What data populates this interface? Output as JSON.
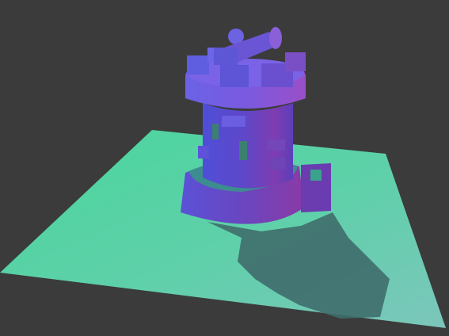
{
  "viewport": {
    "background_color": "#3b3b3b"
  },
  "scene": {
    "shading_mode": "normal-map",
    "objects": [
      {
        "name": "ground-plane",
        "color_near": "#4fd0a3",
        "color_far": "#76c9b5"
      },
      {
        "name": "castle-tower",
        "color_left": "#5a4fd1",
        "color_right": "#8a3fa8"
      },
      {
        "name": "cannon",
        "color": "#6a58d8"
      },
      {
        "name": "tower-shadow",
        "color": "#3d6b6c"
      }
    ]
  }
}
